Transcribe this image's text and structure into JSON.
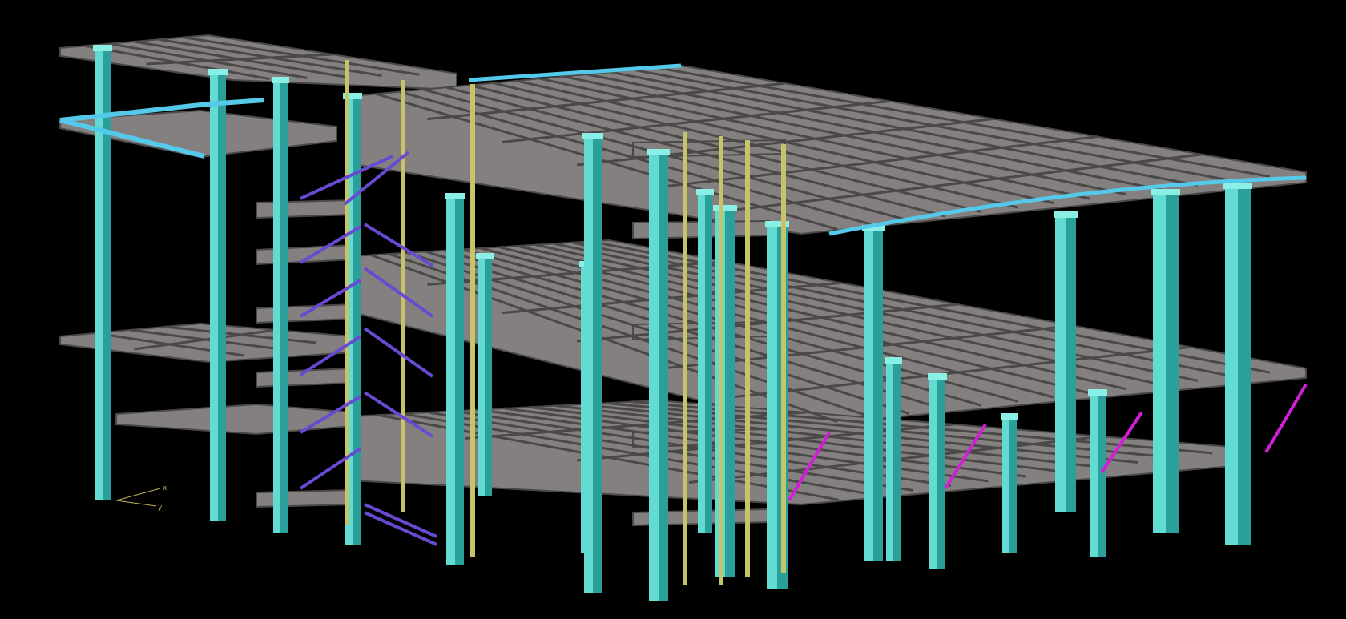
{
  "viewport": {
    "background": "#000000",
    "colors": {
      "slab_top": "#858080",
      "slab_side": "#5f5c5c",
      "slab_edge": "#4b4848",
      "column_light": "#62dcd2",
      "column_dark": "#2b9f99",
      "column_highlight": "#8af0e6",
      "edge_beam": "#55c9ea",
      "yellow_column": "#c7c36a",
      "brace_purple": "#6a49d2",
      "brace_magenta": "#d11fd6",
      "ucs": "#bdb054"
    }
  },
  "ucs": {
    "icon": "ucs-axis-icon",
    "x_label": "x",
    "y_label": "y"
  }
}
